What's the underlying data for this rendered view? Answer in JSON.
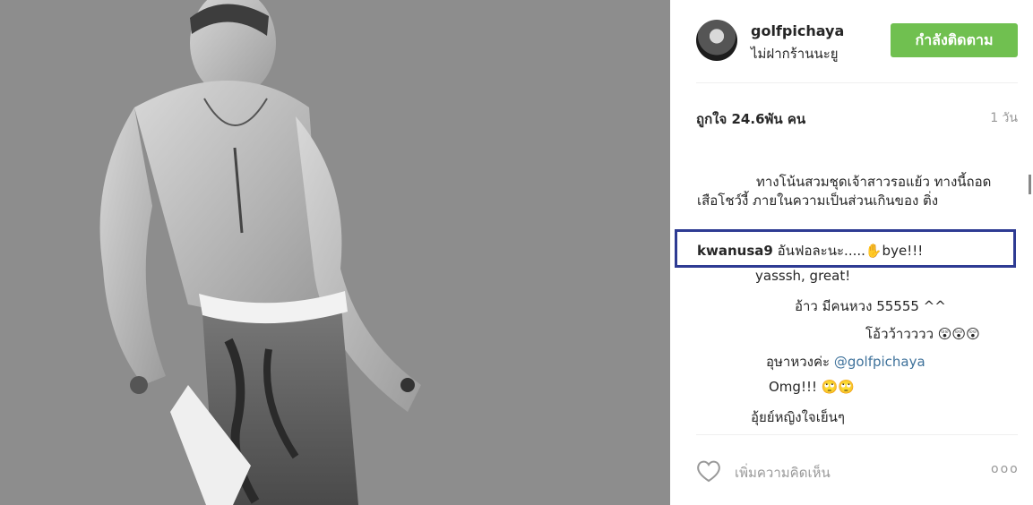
{
  "post": {
    "username": "golfpichaya",
    "subtitle": "ไม่ฝากร้านนะยู",
    "follow_label": "กำลังติดตาม",
    "likes": "ถูกใจ 24.6พัน คน",
    "time": "1 วัน",
    "caption": "ทางโน้นสวมชุดเจ้าสาวรอแย้ว ทางนี้ถอดเสือโชว์งี้ ภายในความเป็นส่วนเกินของ ติ่ง"
  },
  "comments": [
    {
      "user": "kwanusa9",
      "text": "อันฟอละนะ.....✋bye!!!"
    },
    {
      "text": "yasssh, great!"
    },
    {
      "text": "อ้าว มีคนหวง 55555 ^^"
    },
    {
      "text": "โอ้วว้าวววว 😲😲😲"
    },
    {
      "text": "อุษาหวงค่ะ ",
      "mention": "@golfpichaya"
    },
    {
      "text": "Omg!!! 🙄🙄"
    },
    {
      "text": "อุ้ยย์หญิงใจเย็นๆ"
    }
  ],
  "footer": {
    "add_comment_placeholder": "เพิ่มความคิดเห็น",
    "more_label": "ooo",
    "heart_icon": "heart-outline-icon"
  },
  "colors": {
    "follow_button": "#70c050",
    "highlight_box": "#2e3b93",
    "mention": "#3f729b"
  }
}
